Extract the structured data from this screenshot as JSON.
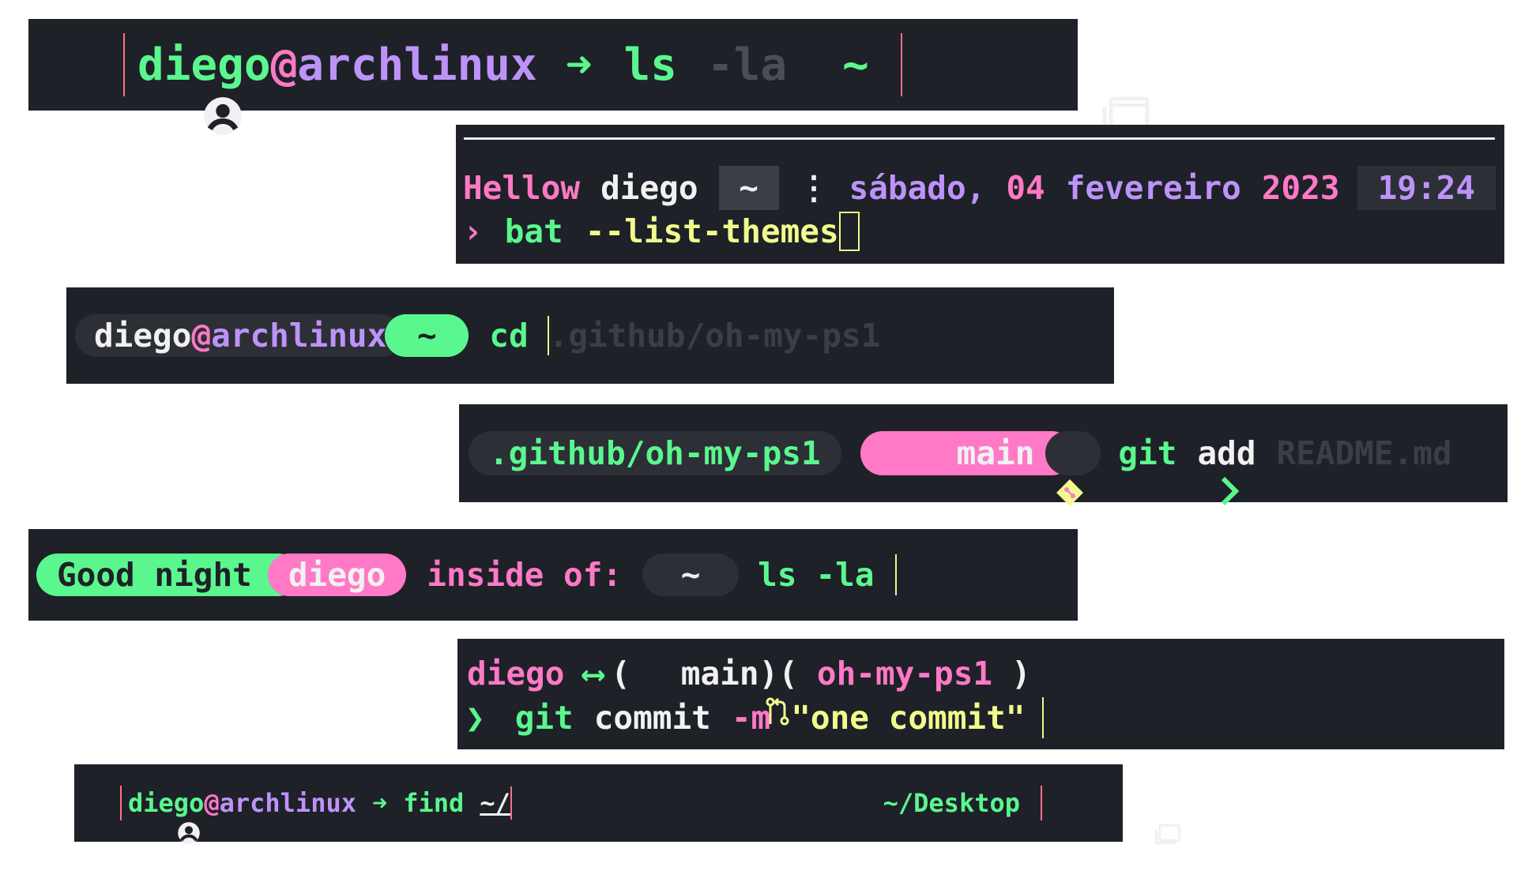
{
  "p1": {
    "user": "diego",
    "at": "@",
    "host": "archlinux",
    "arrow": "➜",
    "cmd": "ls",
    "arg": "-la",
    "path": "~"
  },
  "p2": {
    "greeting": "Hellow",
    "user": "diego",
    "path": "~",
    "sep": "⋮",
    "day": "sábado,",
    "daynum": "04",
    "month": "fevereiro",
    "year": "2023",
    "time": "19:24",
    "prompt": "›",
    "cmd": "bat",
    "arg": "--list-themes"
  },
  "p3": {
    "user": "diego",
    "at": "@",
    "host": "archlinux",
    "path": "~",
    "cmd": "cd",
    "suggestion": ".github/oh-my-ps1"
  },
  "p4": {
    "path": ".github/oh-my-ps1",
    "branch": "main",
    "cmd": "git",
    "sub": "add",
    "file": "README.md"
  },
  "p5": {
    "greeting": "Good night",
    "user": "diego",
    "inside": "inside of:",
    "path": "~",
    "cmd": "ls",
    "arg": "-la"
  },
  "p6": {
    "user": "diego",
    "arrow": "⟷",
    "open1": "(",
    "branch": "main",
    "close1": ")(",
    "repo": "oh-my-ps1",
    "close2": ")",
    "prompt": "❯",
    "cmd": "git",
    "sub": "commit",
    "flag": "-m",
    "msg": "\"one commit\""
  },
  "p7": {
    "user": "diego",
    "at": "@",
    "host": "archlinux",
    "arrow": "➜",
    "cmd": "find",
    "arg": "~/",
    "right_path": "~/Desktop"
  },
  "colors": {
    "panel_bg": "#1e2128",
    "green": "#5af78e",
    "purple": "#bd93f9",
    "pink": "#ff79c6",
    "yellow": "#f1fa8c"
  }
}
